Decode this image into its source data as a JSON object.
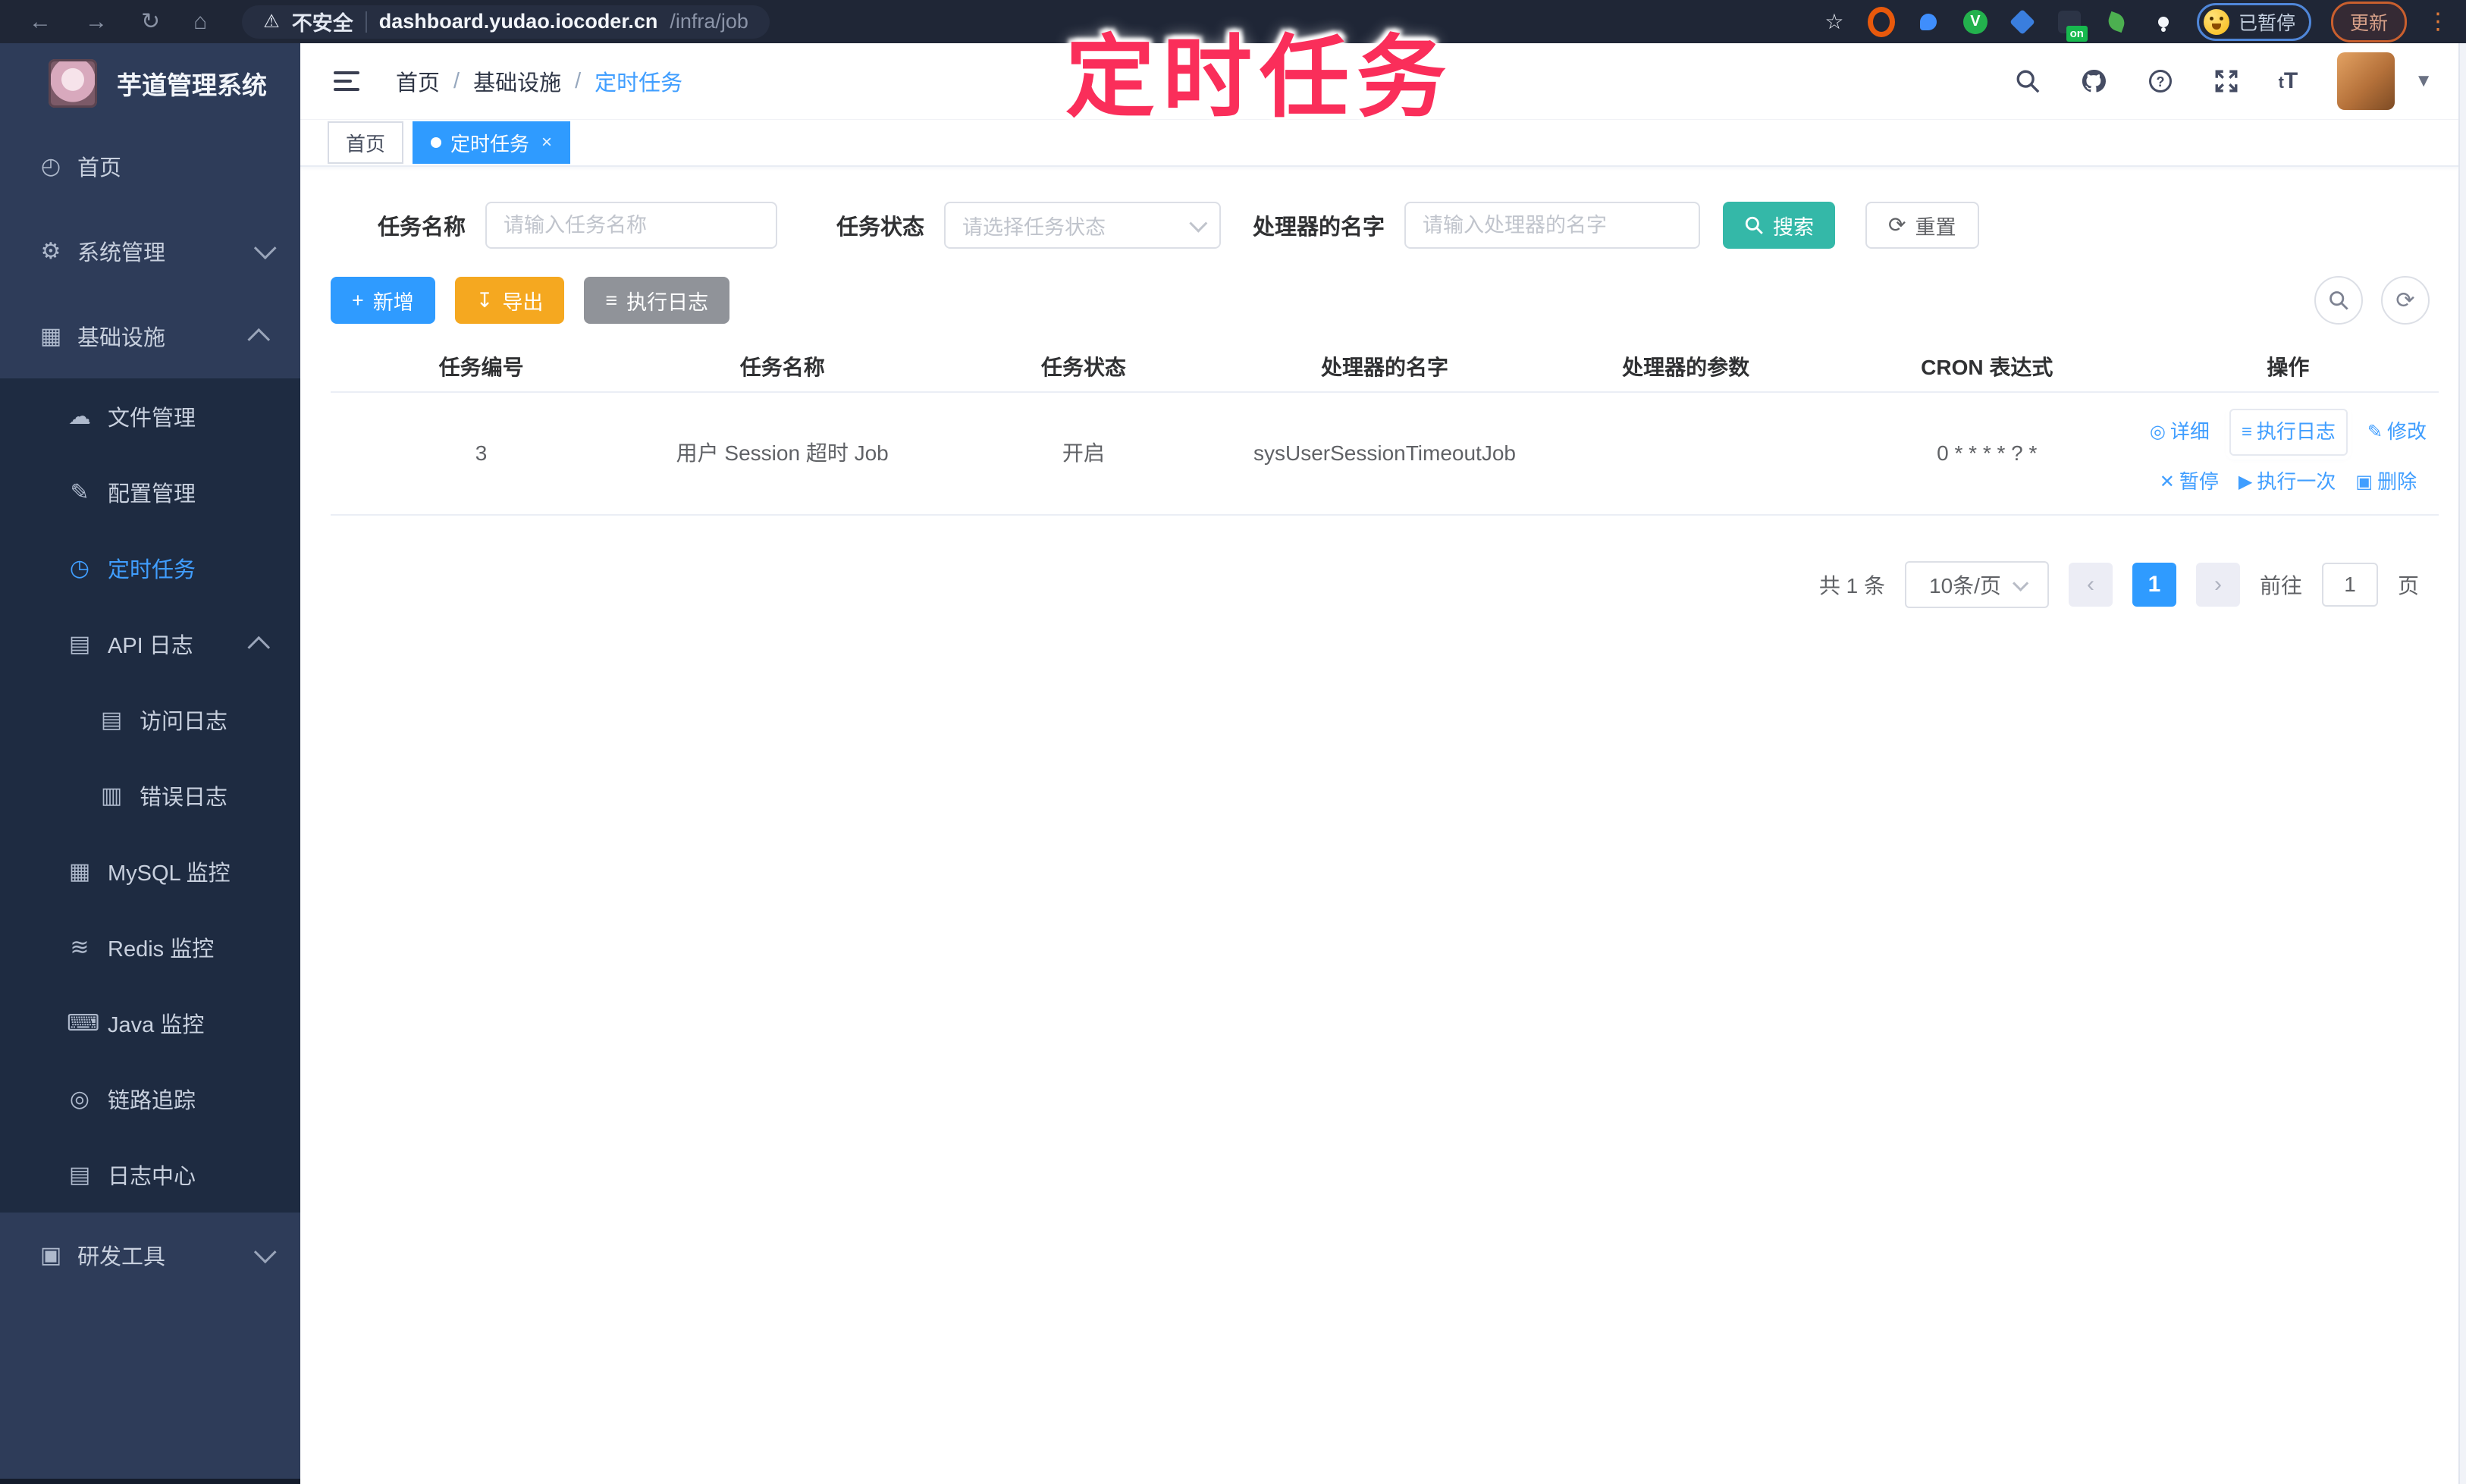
{
  "browser": {
    "back": "←",
    "forward": "→",
    "reload": "↻",
    "home": "⌂",
    "warning_icon": "⚠",
    "security_label": "不安全",
    "url_host": "dashboard.yudao.iocoder.cn",
    "url_path": "/infra/job",
    "star_icon": "☆",
    "extension_on_badge": "on",
    "paused_badge": "已暂停",
    "update_button": "更新",
    "menu_dots": "⋮"
  },
  "annotation": {
    "text": "定时任务"
  },
  "sidebar": {
    "title": "芋道管理系统",
    "items": [
      {
        "label": "首页",
        "icon": "◴"
      },
      {
        "label": "系统管理",
        "icon": "⚙"
      },
      {
        "label": "基础设施",
        "icon": "▦"
      },
      {
        "label": "文件管理",
        "icon": "☁"
      },
      {
        "label": "配置管理",
        "icon": "✎"
      },
      {
        "label": "定时任务",
        "icon": "◷"
      },
      {
        "label": "API 日志",
        "icon": "▤"
      },
      {
        "label": "访问日志",
        "icon": "▤"
      },
      {
        "label": "错误日志",
        "icon": "▥"
      },
      {
        "label": "MySQL 监控",
        "icon": "▦"
      },
      {
        "label": "Redis 监控",
        "icon": "≋"
      },
      {
        "label": "Java 监控",
        "icon": "⌨"
      },
      {
        "label": "链路追踪",
        "icon": "◎"
      },
      {
        "label": "日志中心",
        "icon": "▤"
      },
      {
        "label": "研发工具",
        "icon": "▣"
      }
    ]
  },
  "header": {
    "breadcrumb": [
      "首页",
      "基础设施",
      "定时任务"
    ],
    "separator": "/",
    "font_icon": "tT"
  },
  "tabs": [
    {
      "label": "首页"
    },
    {
      "label": "定时任务",
      "close": "×"
    }
  ],
  "filters": {
    "task_name_label": "任务名称",
    "task_name_placeholder": "请输入任务名称",
    "task_status_label": "任务状态",
    "task_status_placeholder": "请选择任务状态",
    "handler_label": "处理器的名字",
    "handler_placeholder": "请输入处理器的名字",
    "search_label": "搜索",
    "reset_label": "重置",
    "reset_icon": "⟳"
  },
  "toolbar": {
    "add_label": "新增",
    "add_icon": "+",
    "export_label": "导出",
    "export_icon": "↧",
    "exec_log_label": "执行日志",
    "exec_log_icon": "≡",
    "refresh_icon": "⟳"
  },
  "table": {
    "columns": [
      "任务编号",
      "任务名称",
      "任务状态",
      "处理器的名字",
      "处理器的参数",
      "CRON 表达式",
      "操作"
    ],
    "rows": [
      {
        "id": "3",
        "name": "用户 Session 超时 Job",
        "status": "开启",
        "handler": "sysUserSessionTimeoutJob",
        "param": "",
        "cron": "0 * * * * ? *",
        "actions_row1": [
          {
            "icon": "◎",
            "label": "详细"
          },
          {
            "icon": "≡",
            "label": "执行日志"
          },
          {
            "icon": "✎",
            "label": "修改"
          }
        ],
        "actions_row2": [
          {
            "icon": "✕",
            "label": "暂停"
          },
          {
            "icon": "▶",
            "label": "执行一次"
          },
          {
            "icon": "▣",
            "label": "删除"
          }
        ]
      }
    ]
  },
  "pagination": {
    "total": "共 1 条",
    "page_size": "10条/页",
    "prev": "‹",
    "current": "1",
    "next": "›",
    "goto_label": "前往",
    "goto_value": "1",
    "page_label": "页"
  }
}
